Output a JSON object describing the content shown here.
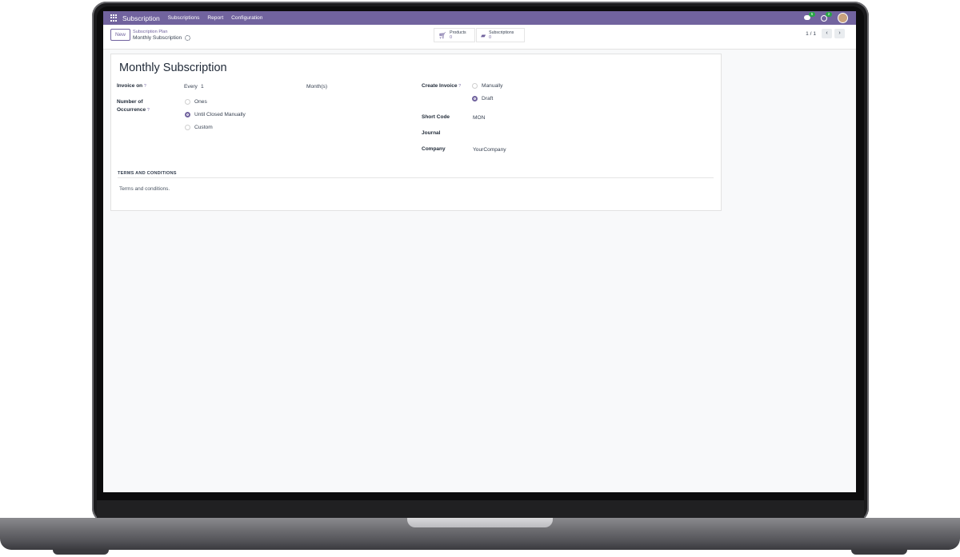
{
  "navbar": {
    "brand": "Subscription",
    "menu": [
      "Subscriptions",
      "Report",
      "Configuration"
    ],
    "messages_count": "5",
    "activities_count": "2"
  },
  "control_panel": {
    "new_label": "New",
    "breadcrumb_parent": "Subscription Plan",
    "breadcrumb_current": "Monthly Subscription",
    "smart_buttons": [
      {
        "label": "Products",
        "value": "0",
        "icon": "cart-icon"
      },
      {
        "label": "Subscriptions",
        "value": "0",
        "icon": "book-icon"
      }
    ],
    "pager": "1 / 1"
  },
  "form": {
    "title": "Monthly Subscription",
    "invoice_on_label": "Invoice on",
    "every_label": "Every",
    "every_value": "1",
    "period_unit": "Month(s)",
    "occurrence_label_1": "Number of",
    "occurrence_label_2": "Occurrence",
    "occurrence_options": [
      "Ones",
      "Until Closed Manually",
      "Custom"
    ],
    "occurrence_selected": "Until Closed Manually",
    "create_invoice_label": "Create Invoice",
    "create_invoice_options": [
      "Manually",
      "Draft"
    ],
    "create_invoice_selected": "Draft",
    "short_code_label": "Short Code",
    "short_code_value": "MON",
    "journal_label": "Journal",
    "journal_value": "",
    "company_label": "Company",
    "company_value": "YourCompany",
    "terms_header": "TERMS AND CONDITIONS",
    "terms_text": "Terms and conditions."
  },
  "colors": {
    "brand": "#71639e",
    "badge": "#28a745"
  }
}
